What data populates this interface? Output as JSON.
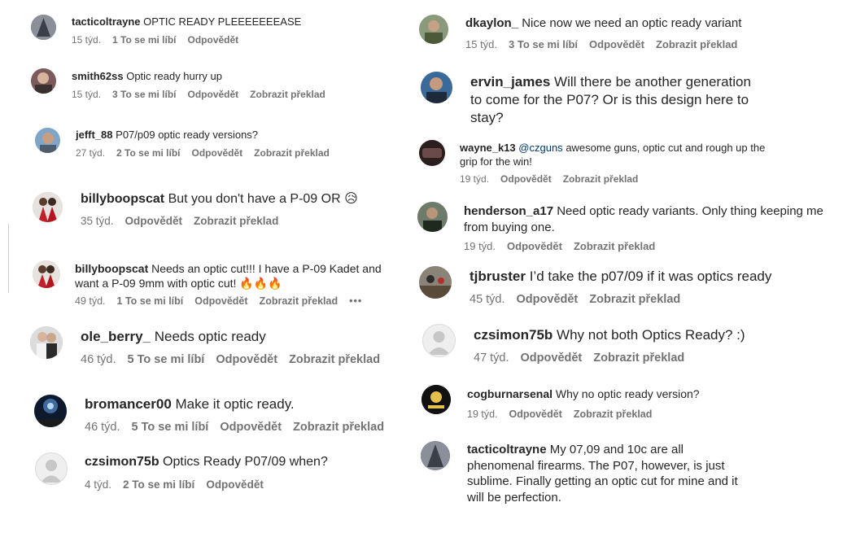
{
  "colors": {
    "text": "#262626",
    "meta": "#737373",
    "mention": "#00376b"
  },
  "left": [
    {
      "user": "tacticoltrayne",
      "text": "OPTIC READY PLEEEEEEEASE",
      "time": "15 týd.",
      "likes": "1 To se mi líbí",
      "reply": "Odpovědět",
      "translate": ""
    },
    {
      "user": "smith62ss",
      "text": "Optic ready hurry up",
      "time": "15 týd.",
      "likes": "3 To se mi líbí",
      "reply": "Odpovědět",
      "translate": "Zobrazit překlad"
    },
    {
      "user": "jefft_88",
      "text": "P07/p09 optic ready versions?",
      "time": "27 týd.",
      "likes": "2 To se mi líbí",
      "reply": "Odpovědět",
      "translate": "Zobrazit překlad"
    },
    {
      "user": "billyboopscat",
      "text": "But you don't have a P-09 OR 😥",
      "time": "35 týd.",
      "likes": "",
      "reply": "Odpovědět",
      "translate": "Zobrazit překlad"
    },
    {
      "user": "billyboopscat",
      "text": "Needs an optic cut!!! I have a P-09 Kadet and want a P-09 9mm with optic cut! 🔥🔥🔥",
      "time": "49 týd.",
      "likes": "1 To se mi líbí",
      "reply": "Odpovědět",
      "translate": "Zobrazit překlad",
      "more": "•••"
    },
    {
      "user": "ole_berry_",
      "text": "Needs optic ready",
      "time": "46 týd.",
      "likes": "5 To se mi líbí",
      "reply": "Odpovědět",
      "translate": "Zobrazit překlad"
    },
    {
      "user": "bromancer00",
      "text": "Make it optic ready.",
      "time": "46 týd.",
      "likes": "5 To se mi líbí",
      "reply": "Odpovědět",
      "translate": "Zobrazit překlad"
    },
    {
      "user": "czsimon75b",
      "text": "Optics Ready P07/09 when?",
      "time": "4 týd.",
      "likes": "2 To se mi líbí",
      "reply": "Odpovědět",
      "translate": ""
    }
  ],
  "right": [
    {
      "user": "dkaylon_",
      "text": "Nice now we need an optic ready variant",
      "time": "15 týd.",
      "likes": "3 To se mi líbí",
      "reply": "Odpovědět",
      "translate": "Zobrazit překlad"
    },
    {
      "user": "ervin_james",
      "text": "Will there be another generation to come for the P07? Or is this design here to stay?",
      "time": "",
      "likes": "",
      "reply": "",
      "translate": ""
    },
    {
      "user": "wayne_k13",
      "mention": "@czguns",
      "text": "awesome guns, optic cut and rough up the grip for the win!",
      "time": "19 týd.",
      "likes": "",
      "reply": "Odpovědět",
      "translate": "Zobrazit překlad"
    },
    {
      "user": "henderson_a17",
      "text": "Need optic ready variants. Only thing keeping me from buying one.",
      "time": "19 týd.",
      "likes": "",
      "reply": "Odpovědět",
      "translate": "Zobrazit překlad"
    },
    {
      "user": "tjbruster",
      "text": "I’d take the p07/09 if it was optics ready",
      "time": "45 týd.",
      "likes": "",
      "reply": "Odpovědět",
      "translate": "Zobrazit překlad"
    },
    {
      "user": "czsimon75b",
      "text": "Why not both Optics Ready? :)",
      "time": "47 týd.",
      "likes": "",
      "reply": "Odpovědět",
      "translate": "Zobrazit překlad"
    },
    {
      "user": "cogburnarsenal",
      "text": "Why no optic ready version?",
      "time": "19 týd.",
      "likes": "",
      "reply": "Odpovědět",
      "translate": "Zobrazit překlad"
    },
    {
      "user": "tacticoltrayne",
      "text": "My 07,09 and 10c are all phenomenal firearms. The P07, however, is just sublime. Finally getting an optic cut for mine and it will be perfection.",
      "time": "",
      "likes": "",
      "reply": "",
      "translate": ""
    }
  ]
}
